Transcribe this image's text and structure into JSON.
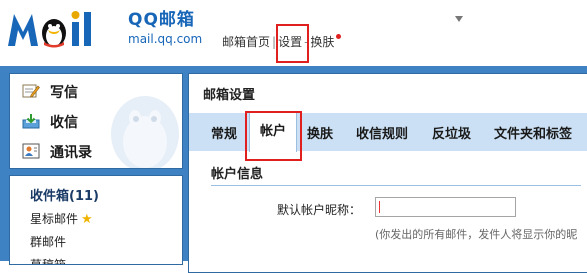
{
  "header": {
    "brand_cn": "QQ邮箱",
    "brand_domain": "mail.qq.com",
    "nav": {
      "home": "邮箱首页",
      "separator": "|",
      "settings": "设置",
      "dash": "-",
      "skin": "换肤"
    }
  },
  "sidebar": {
    "actions": [
      {
        "label": "写信",
        "icon": "compose-icon"
      },
      {
        "label": "收信",
        "icon": "receive-icon"
      },
      {
        "label": "通讯录",
        "icon": "contacts-icon"
      }
    ],
    "folders": {
      "inbox": "收件箱(11)",
      "starred": "星标邮件",
      "group": "群邮件",
      "drafts": "草稿箱"
    }
  },
  "main": {
    "title": "邮箱设置",
    "tabs": [
      "常规",
      "帐户",
      "换肤",
      "收信规则",
      "反垃圾",
      "文件夹和标签"
    ],
    "active_tab": "帐户",
    "section_title": "帐户信息",
    "nickname_label": "默认帐户昵称：",
    "nickname_value": "",
    "note": "(你发出的所有邮件，发件人将显示你的昵"
  },
  "colors": {
    "brand_blue": "#1766b8",
    "frame_blue": "#3f82c4",
    "tabbar_bg": "#cbe0f4",
    "highlight_red": "#e0201e",
    "notification_dot": "#e02020",
    "star": "#f0b400"
  }
}
